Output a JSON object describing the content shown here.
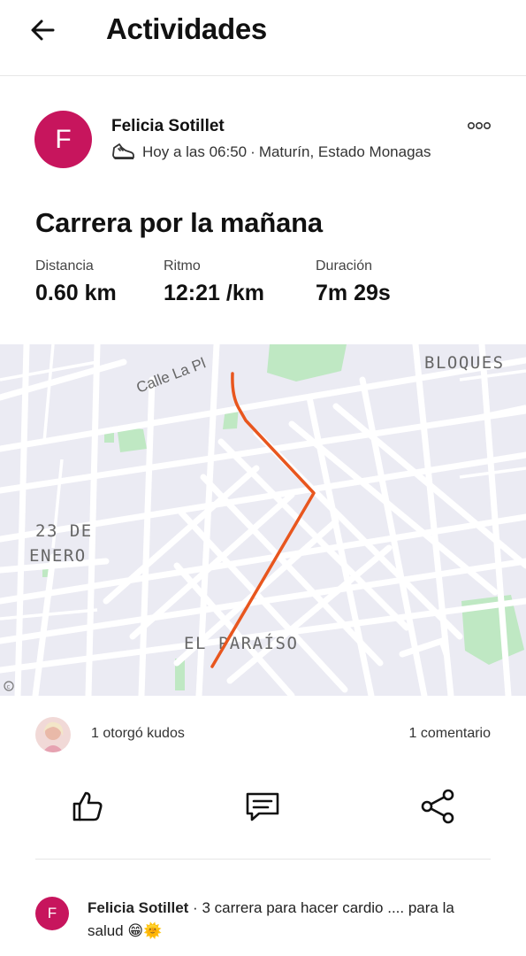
{
  "header": {
    "title": "Actividades",
    "back_icon": "arrow-left-icon"
  },
  "athlete": {
    "avatar_initial": "F",
    "avatar_color": "#c7155d",
    "name": "Felicia Sotillet",
    "time": "Hoy a las 06:50",
    "separator": "·",
    "location": "Maturín, Estado Monagas",
    "activity_icon": "running-shoe-icon",
    "more_icon": "more-options-icon"
  },
  "activity": {
    "title": "Carrera por la mañana",
    "stats": [
      {
        "label": "Distancia",
        "value": "0.60 km"
      },
      {
        "label": "Ritmo",
        "value": "12:21 /km"
      },
      {
        "label": "Duración",
        "value": "7m 29s"
      }
    ]
  },
  "map": {
    "labels": {
      "street": "Calle La Pl",
      "district_1": "BLOQUES",
      "district_2_line1": "23 DE",
      "district_2_line2": "ENERO",
      "district_3": "EL PARAÍSO"
    },
    "attribution_icon": "copyright-icon",
    "route_color": "#e8561e",
    "park_color": "#bfe8c3",
    "background_color": "#ebebf3"
  },
  "social": {
    "kudos_text": "1 otorgó kudos",
    "comments_text": "1 comentario",
    "kudos_icon": "thumbs-up-icon",
    "comment_icon": "comment-icon",
    "share_icon": "share-icon"
  },
  "comment": {
    "author_initial": "F",
    "author": "Felicia Sotillet",
    "separator": "·",
    "text": "3 carrera para hacer cardio .... para la salud",
    "emoji": "😁🌞"
  }
}
